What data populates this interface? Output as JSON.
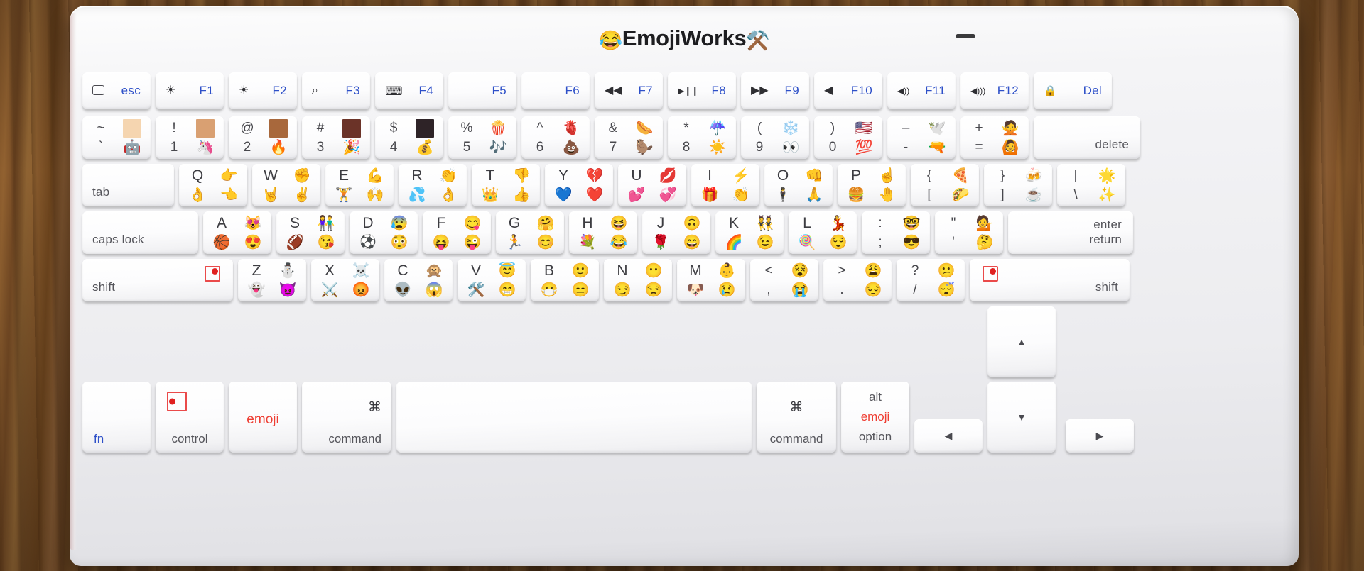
{
  "brand": {
    "emoji_left": "😂",
    "text": "EmojiWorks",
    "emoji_right": "⚒️"
  },
  "colors": {
    "label_blue": "#2e50c8",
    "accent_red": "#ee3d32",
    "key_text": "#55555b"
  },
  "rows": {
    "function": [
      {
        "name": "esc",
        "icon": "rounded-square",
        "label": "esc"
      },
      {
        "name": "f1",
        "icon": "☀",
        "label": "F1"
      },
      {
        "name": "f2",
        "icon": "☀",
        "label": "F2"
      },
      {
        "name": "f3",
        "icon": "⌕",
        "label": "F3"
      },
      {
        "name": "f4",
        "icon": "⌨",
        "label": "F4"
      },
      {
        "name": "f5",
        "icon": "",
        "label": "F5"
      },
      {
        "name": "f6",
        "icon": "",
        "label": "F6"
      },
      {
        "name": "f7",
        "icon": "◀◀",
        "label": "F7"
      },
      {
        "name": "f8",
        "icon": "▶❙❙",
        "label": "F8"
      },
      {
        "name": "f9",
        "icon": "▶▶",
        "label": "F9"
      },
      {
        "name": "f10",
        "icon": "◀",
        "label": "F10"
      },
      {
        "name": "f11",
        "icon": "◀))",
        "label": "F11"
      },
      {
        "name": "f12",
        "icon": "◀)))",
        "label": "F12"
      },
      {
        "name": "del",
        "icon": "🔒",
        "label": "Del"
      }
    ],
    "number": [
      {
        "name": "backtick",
        "tl": "~",
        "tr_swatch": "#f5d5b0",
        "bl": "`",
        "br": "🤖"
      },
      {
        "name": "one",
        "tl": "!",
        "tr_swatch": "#d9a072",
        "bl": "1",
        "br": "🦄"
      },
      {
        "name": "two",
        "tl": "@",
        "tr_swatch": "#a8683c",
        "bl": "2",
        "br": "🔥"
      },
      {
        "name": "three",
        "tl": "#",
        "tr_swatch": "#6b3328",
        "bl": "3",
        "br": "🎉"
      },
      {
        "name": "four",
        "tl": "$",
        "tr_swatch": "#2e2327",
        "bl": "4",
        "br": "💰"
      },
      {
        "name": "five",
        "tl": "%",
        "tr": "🍿",
        "bl": "5",
        "br": "🎶"
      },
      {
        "name": "six",
        "tl": "^",
        "tr": "🫀",
        "bl": "6",
        "br": "💩"
      },
      {
        "name": "seven",
        "tl": "&",
        "tr": "🌭",
        "bl": "7",
        "br": "🦫"
      },
      {
        "name": "eight",
        "tl": "*",
        "tr": "☔",
        "bl": "8",
        "br": "☀️"
      },
      {
        "name": "nine",
        "tl": "(",
        "tr": "❄️",
        "bl": "9",
        "br": "👀"
      },
      {
        "name": "zero",
        "tl": ")",
        "tr": "🇺🇸",
        "bl": "0",
        "br": "💯"
      },
      {
        "name": "minus",
        "tl": "–",
        "tr": "🕊️",
        "bl": "-",
        "br": "🔫"
      },
      {
        "name": "equal",
        "tl": "+",
        "tr": "🙅",
        "bl": "=",
        "br": "🙆"
      }
    ],
    "number_end": {
      "name": "delete",
      "label": "delete"
    },
    "qwerty_start": {
      "name": "tab",
      "label": "tab"
    },
    "qwerty": [
      {
        "name": "q",
        "tl": "Q",
        "tr": "👉",
        "bl": "👌",
        "br": "👈"
      },
      {
        "name": "w",
        "tl": "W",
        "tr": "✊",
        "bl": "🤘",
        "br": "✌️"
      },
      {
        "name": "e",
        "tl": "E",
        "tr": "💪",
        "bl": "🏋️",
        "br": "🙌"
      },
      {
        "name": "r",
        "tl": "R",
        "tr": "👏",
        "bl": "💦",
        "br": "👌"
      },
      {
        "name": "t",
        "tl": "T",
        "tr": "👎",
        "bl": "👑",
        "br": "👍"
      },
      {
        "name": "y",
        "tl": "Y",
        "tr": "💔",
        "bl": "💙",
        "br": "❤️"
      },
      {
        "name": "u",
        "tl": "U",
        "tr": "💋",
        "bl": "💕",
        "br": "💞"
      },
      {
        "name": "i",
        "tl": "I",
        "tr": "⚡",
        "bl": "🎁",
        "br": "👏"
      },
      {
        "name": "o",
        "tl": "O",
        "tr": "👊",
        "bl": "🕴️",
        "br": "🙏"
      },
      {
        "name": "p",
        "tl": "P",
        "tr": "☝️",
        "bl": "🍔",
        "br": "🤚"
      },
      {
        "name": "bracket-left",
        "tl": "{",
        "tr": "🍕",
        "bl": "[",
        "br": "🌮"
      },
      {
        "name": "bracket-right",
        "tl": "}",
        "tr": "🍻",
        "bl": "]",
        "br": "☕"
      },
      {
        "name": "backslash",
        "tl": "|",
        "tr": "🌟",
        "bl": "\\",
        "br": "✨"
      }
    ],
    "home_start": {
      "name": "caps-lock",
      "label": "caps lock"
    },
    "home": [
      {
        "name": "a",
        "tl": "A",
        "tr": "😻",
        "bl": "🏀",
        "br": "😍"
      },
      {
        "name": "s",
        "tl": "S",
        "tr": "👫",
        "bl": "🏈",
        "br": "😘"
      },
      {
        "name": "d",
        "tl": "D",
        "tr": "😰",
        "bl": "⚽",
        "br": "😳"
      },
      {
        "name": "f",
        "tl": "F",
        "tr": "😋",
        "bl": "😝",
        "br": "😜"
      },
      {
        "name": "g",
        "tl": "G",
        "tr": "🤗",
        "bl": "🏃",
        "br": "😊"
      },
      {
        "name": "h",
        "tl": "H",
        "tr": "😆",
        "bl": "💐",
        "br": "😂"
      },
      {
        "name": "j",
        "tl": "J",
        "tr": "🙃",
        "bl": "🌹",
        "br": "😄"
      },
      {
        "name": "k",
        "tl": "K",
        "tr": "👯",
        "bl": "🌈",
        "br": "😉"
      },
      {
        "name": "l",
        "tl": "L",
        "tr": "💃",
        "bl": "🍭",
        "br": "😌"
      },
      {
        "name": "semicolon",
        "tl": ":",
        "tr": "🤓",
        "bl": ";",
        "br": "😎"
      },
      {
        "name": "quote",
        "tl": "\"",
        "tr": "💁",
        "bl": "'",
        "br": "🤔"
      }
    ],
    "home_end": {
      "name": "enter",
      "label_top": "enter",
      "label_bottom": "return"
    },
    "shift_left": {
      "name": "shift-left",
      "label": "shift",
      "icon": "red-square-dot"
    },
    "zxcv": [
      {
        "name": "z",
        "tl": "Z",
        "tr": "⛄",
        "bl": "👻",
        "br": "😈"
      },
      {
        "name": "x",
        "tl": "X",
        "tr": "☠️",
        "bl": "⚔️",
        "br": "😡"
      },
      {
        "name": "c",
        "tl": "C",
        "tr": "🙊",
        "bl": "👽",
        "br": "😱"
      },
      {
        "name": "v",
        "tl": "V",
        "tr": "😇",
        "bl": "🛠️",
        "br": "😁"
      },
      {
        "name": "b",
        "tl": "B",
        "tr": "🙂",
        "bl": "😷",
        "br": "😑"
      },
      {
        "name": "n",
        "tl": "N",
        "tr": "😶",
        "bl": "😏",
        "br": "😒"
      },
      {
        "name": "m",
        "tl": "M",
        "tr": "👶",
        "bl": "🐶",
        "br": "😢"
      },
      {
        "name": "comma",
        "tl": "<",
        "tr": "😵",
        "bl": ",",
        "br": "😭"
      },
      {
        "name": "period",
        "tl": ">",
        "tr": "😩",
        "bl": ".",
        "br": "😔"
      },
      {
        "name": "slash",
        "tl": "?",
        "tr": "😕",
        "bl": "/",
        "br": "😴"
      }
    ],
    "shift_right": {
      "name": "shift-right",
      "label": "shift",
      "icon": "red-square-dot"
    },
    "bottom": [
      {
        "name": "fn",
        "top": "",
        "bottom": "fn",
        "style": "blue"
      },
      {
        "name": "control",
        "top": "red-square-dot",
        "bottom": "control"
      },
      {
        "name": "emoji",
        "top": "emoji",
        "bottom": "",
        "style": "red"
      },
      {
        "name": "command-left",
        "top": "⌘",
        "bottom": "command"
      },
      {
        "name": "space",
        "top": "",
        "bottom": ""
      },
      {
        "name": "command-right",
        "top": "⌘",
        "bottom": "command"
      },
      {
        "name": "alt-option",
        "top": "alt",
        "mid": "emoji",
        "bottom": "option"
      }
    ],
    "arrows": {
      "up": "▲",
      "down": "▼",
      "left": "◀",
      "right": "▶"
    }
  }
}
